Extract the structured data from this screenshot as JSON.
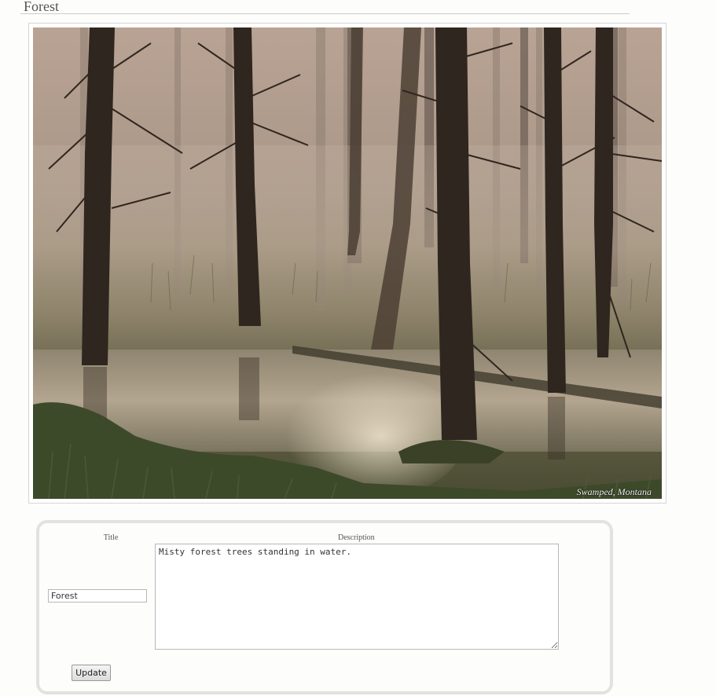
{
  "page": {
    "title": "Forest"
  },
  "photo": {
    "caption": "Swamped, Montana"
  },
  "form": {
    "title_label": "Title",
    "description_label": "Description",
    "title_value": "Forest",
    "description_value": "Misty forest trees standing in water.",
    "update_label": "Update"
  }
}
